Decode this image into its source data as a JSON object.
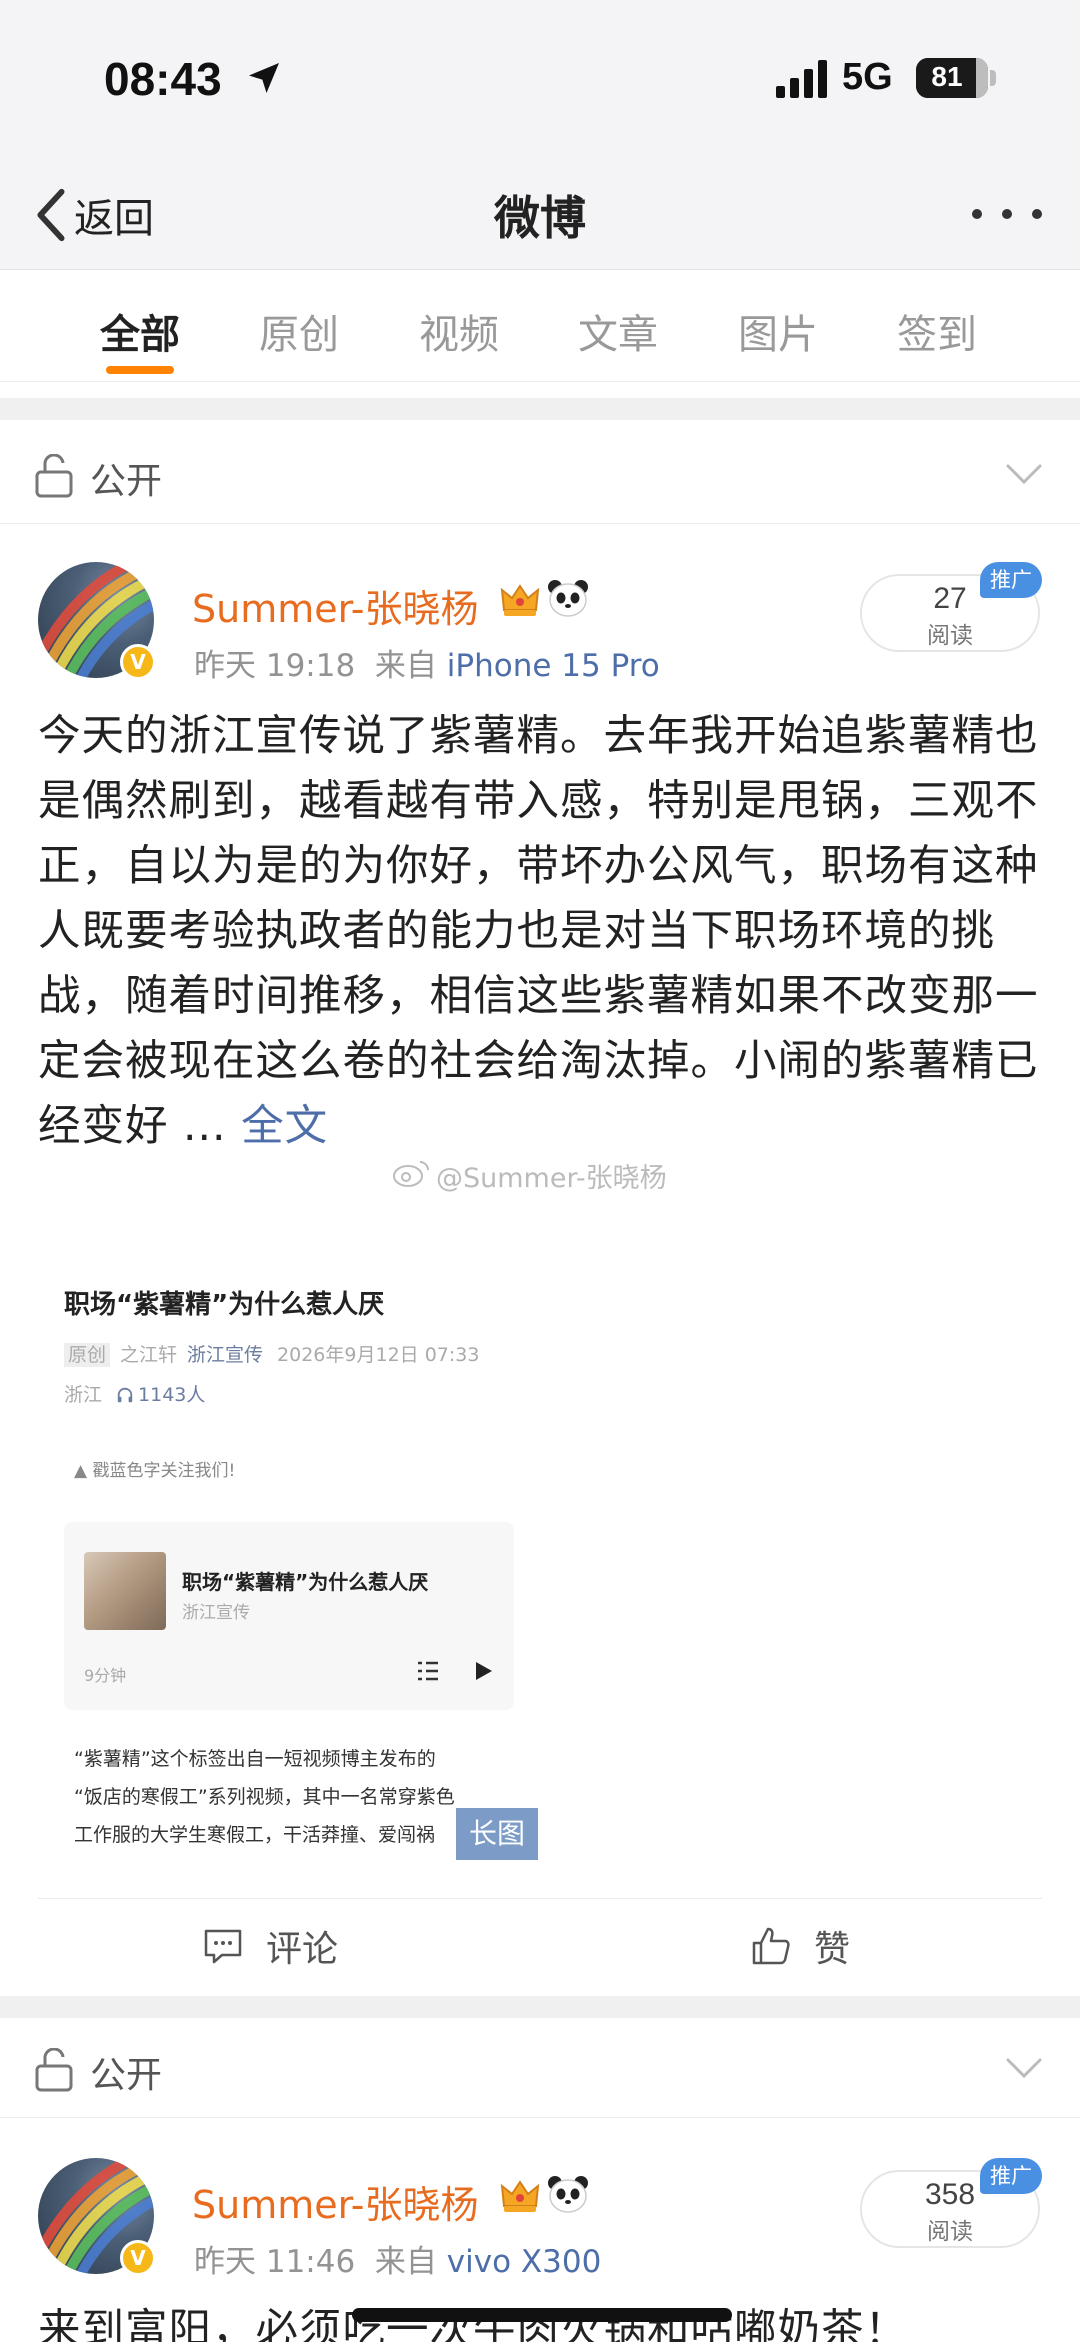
{
  "status_bar": {
    "time": "08:43",
    "network": "5G",
    "battery": "81",
    "battery_level": 0.81,
    "icons": [
      "location-arrow-icon",
      "cell-signal-icon",
      "battery-icon"
    ]
  },
  "nav": {
    "back_label": "返回",
    "title": "微博",
    "more_icon": "more-dots-icon"
  },
  "tabs": {
    "items": [
      "全部",
      "原创",
      "视频",
      "文章",
      "图片",
      "签到"
    ],
    "active_index": 0
  },
  "colors": {
    "accent": "#ff8200",
    "username": "#e86c1f",
    "link": "#4d6ea8",
    "promo": "#4a90e2",
    "verified": "#f6b818"
  },
  "posts": [
    {
      "visibility": "公开",
      "username": "Summer-张晓杨",
      "time": "昨天 19:18",
      "from_label": "来自",
      "source": "iPhone 15 Pro",
      "read_count": "27",
      "read_label": "阅读",
      "promo_label": "推广",
      "text": "今天的浙江宣传说了紫薯精。去年我开始追紫薯精也是偶然刷到，越看越有带入感，特别是甩锅，三观不正，自以为是的为你好，带坏办公风气，职场有这种人既要考验执政者的能力也是对当下职场环境的挑战，随着时间推移，相信这些紫薯精如果不改变那一定会被现在这么卷的社会给淘汰掉。小闹的紫薯精已经变好 ...",
      "full_text_link": "全文",
      "watermark": "@Summer-张晓杨",
      "image": {
        "title": "职场“紫薯精”为什么惹人厌",
        "original_tag": "原创",
        "author": "之江轩",
        "account": "浙江宣传",
        "date": "2026年9月12日 07:33",
        "region": "浙江",
        "listeners": "1143人",
        "follow_hint": "▲ 戳蓝色字关注我们!",
        "audio_title": "职场“紫薯精”为什么惹人厌",
        "audio_account": "浙江宣传",
        "audio_duration": "9分钟",
        "body_lines": [
          "“紫薯精”这个标签出自一短视频博主发布的",
          "“饭店的寒假工”系列视频，其中一名常穿紫色",
          "工作服的大学生寒假工，干活莽撞、爱闯祸"
        ],
        "long_image_tag": "长图"
      },
      "comment_label": "评论",
      "like_label": "赞"
    },
    {
      "visibility": "公开",
      "username": "Summer-张晓杨",
      "time": "昨天 11:46",
      "from_label": "来自",
      "source": "vivo X300",
      "read_count": "358",
      "read_label": "阅读",
      "promo_label": "推广",
      "text": "来到富阳，必须吃一次牛肉火锅和咕嘟奶茶！"
    }
  ]
}
